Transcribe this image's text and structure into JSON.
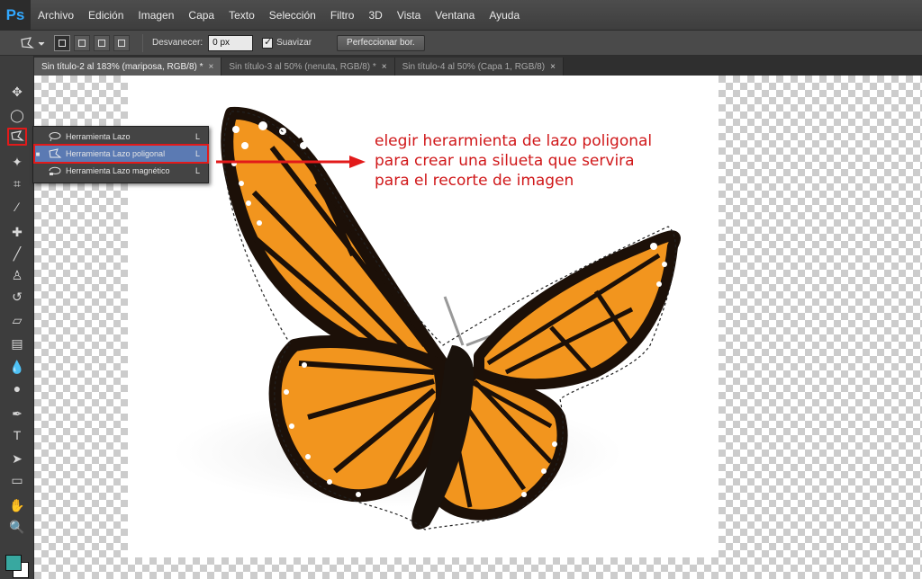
{
  "app": {
    "logo": "Ps"
  },
  "menu": [
    "Archivo",
    "Edición",
    "Imagen",
    "Capa",
    "Texto",
    "Selección",
    "Filtro",
    "3D",
    "Vista",
    "Ventana",
    "Ayuda"
  ],
  "options": {
    "feather_label": "Desvanecer:",
    "feather_value": "0 px",
    "antialias_label": "Suavizar",
    "antialias_checked": true,
    "refine_button": "Perfeccionar bor."
  },
  "tabs": [
    {
      "label": "Sin título-2 al 183% (mariposa, RGB/8) *",
      "active": true
    },
    {
      "label": "Sin título-3 al 50% (nenuta, RGB/8) *",
      "active": false
    },
    {
      "label": "Sin título-4 al 50% (Capa 1, RGB/8)",
      "active": false
    }
  ],
  "flyout": {
    "items": [
      {
        "label": "Herramienta Lazo",
        "key": "L",
        "icon": "lasso-icon",
        "selected": false
      },
      {
        "label": "Herramienta Lazo poligonal",
        "key": "L",
        "icon": "polygonal-lasso-icon",
        "selected": true
      },
      {
        "label": "Herramienta Lazo magnético",
        "key": "L",
        "icon": "magnetic-lasso-icon",
        "selected": false
      }
    ]
  },
  "annotation": {
    "lines": [
      "elegir herarmienta de lazo poligonal",
      "para crear una silueta que servira",
      "para el recorte de imagen"
    ],
    "color": "#d0181a"
  },
  "colors": {
    "foreground": "#38a8a0",
    "background": "#ffffff",
    "highlight": "#e21a1a"
  }
}
